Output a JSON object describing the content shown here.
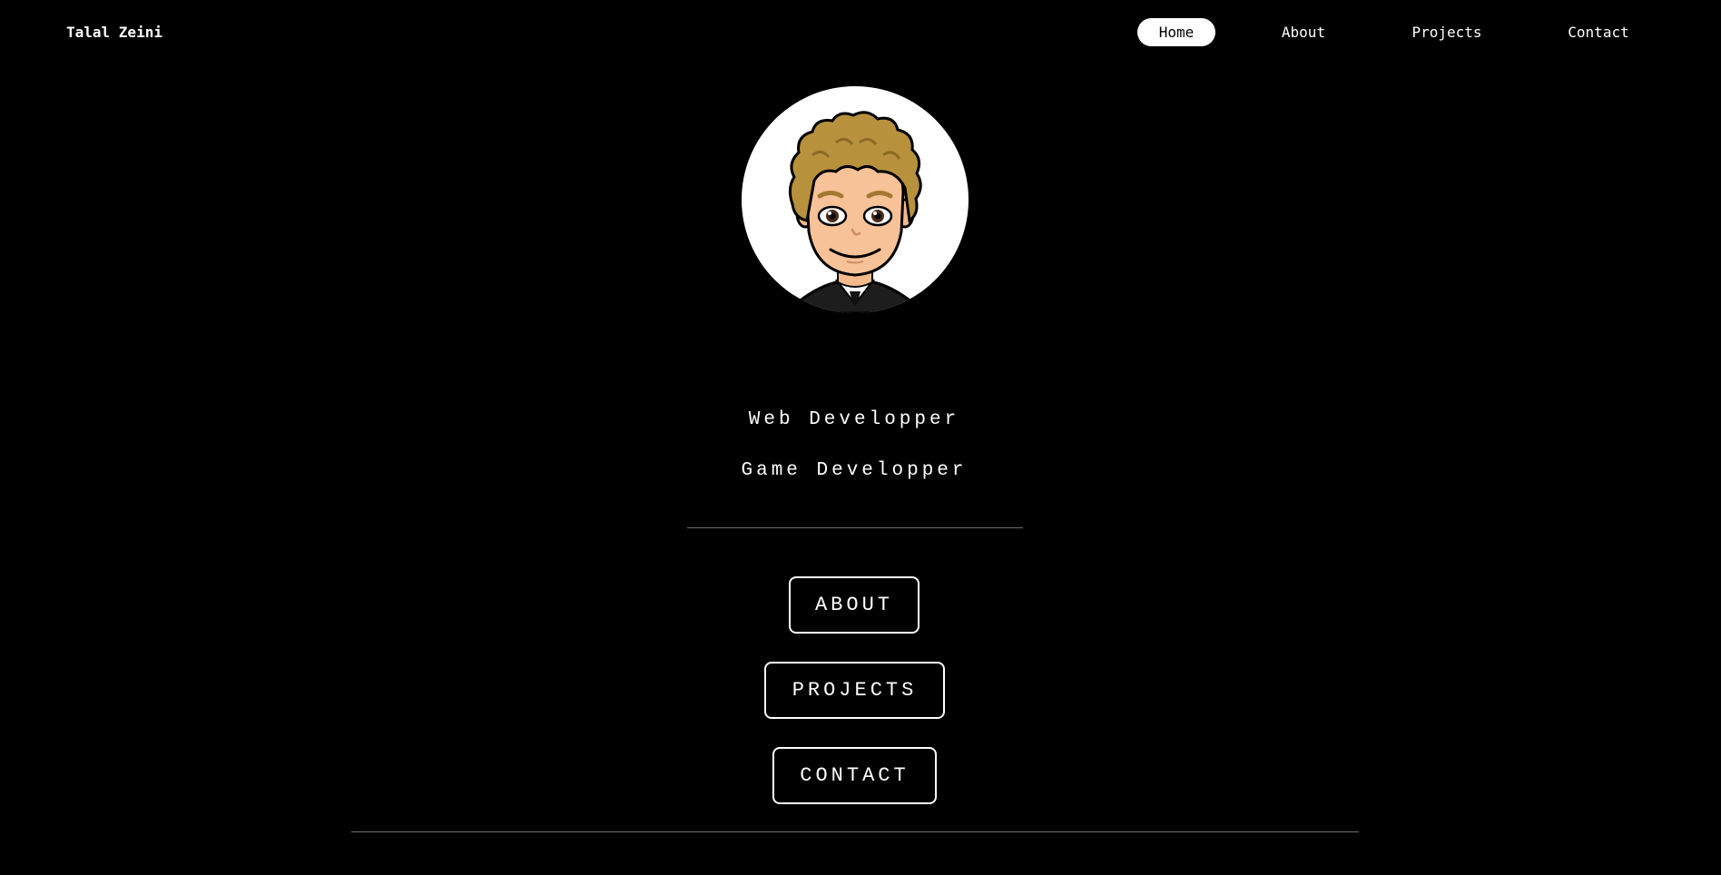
{
  "header": {
    "brand": "Talal Zeini",
    "nav": [
      {
        "label": "Home",
        "active": true
      },
      {
        "label": "About",
        "active": false
      },
      {
        "label": "Projects",
        "active": false
      },
      {
        "label": "Contact",
        "active": false
      }
    ]
  },
  "hero": {
    "avatar_icon": "bitmoji-avatar-icon",
    "roles": [
      "Web Developper",
      "Game Developper"
    ]
  },
  "buttons": {
    "about": "ABOUT",
    "projects": "PROJECTS",
    "contact": "CONTACT"
  },
  "colors": {
    "background": "#000000",
    "foreground": "#ffffff",
    "divider": "#6e6e6e"
  }
}
